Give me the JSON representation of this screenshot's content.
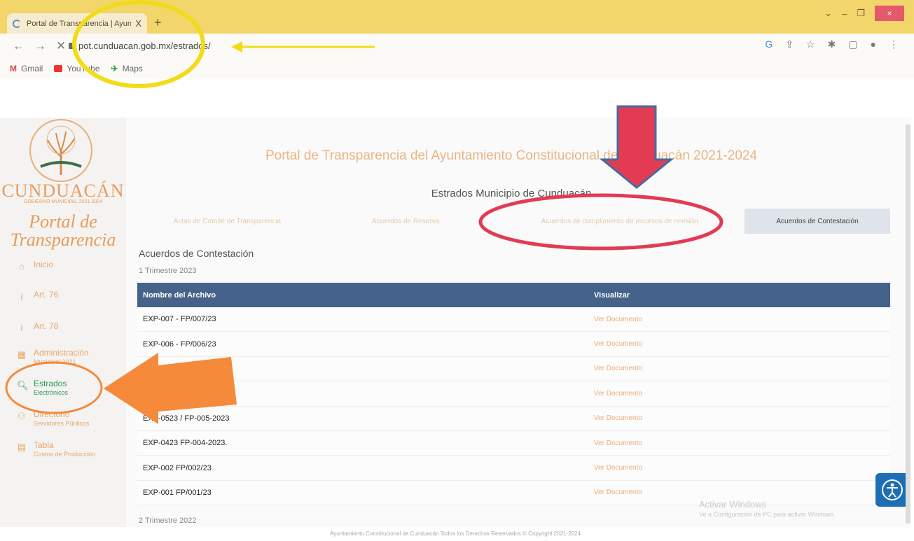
{
  "browser": {
    "tab_title": "Portal de Transparencia | Ayuntam",
    "tab_close": "X",
    "new_tab": "+",
    "url": "pot.cunduacan.gob.mx/estrados/",
    "bookmarks": [
      {
        "label": "Gmail",
        "icon": "gmail-icon"
      },
      {
        "label": "YouTube",
        "icon": "youtube-icon"
      },
      {
        "label": "Maps",
        "icon": "maps-icon"
      }
    ],
    "window_close": "×"
  },
  "sidebar": {
    "logo_text": "CUNDUACÁN",
    "logo_sub": "GOBIERNO MUNICIPAL 2021-2024",
    "portal_line1": "Portal de",
    "portal_line2": "Transparencia",
    "items": [
      {
        "label": "Inicio",
        "sub": "",
        "icon": "home-icon"
      },
      {
        "label": "Art. 76",
        "sub": "",
        "icon": "info-icon"
      },
      {
        "label": "Art. 78",
        "sub": "",
        "icon": "info-icon"
      },
      {
        "label": "Administración",
        "sub": "Municipal 2021",
        "icon": "calendar-icon"
      },
      {
        "label": "Estrados",
        "sub": "Electrónicos",
        "icon": "search-icon"
      },
      {
        "label": "Directorio",
        "sub": "Servidores Públicos",
        "icon": "people-icon"
      },
      {
        "label": "Tabla",
        "sub": "Costos de Producción",
        "icon": "table-icon"
      }
    ]
  },
  "content": {
    "site_title": "Portal de Transparencia del Ayuntamiento Constitucional de Cunduacán  2021-2024",
    "estrados_title": "Estrados Municipio de Cunduacán",
    "tabs": [
      "Actas de Comité de Transparencia",
      "Acuerdos de Reserva",
      "Acuerdos de cumplimiento de recursos de revisión",
      "Acuerdos de Contestación"
    ],
    "section_heading": "Acuerdos de Contestación",
    "period": "1 Trimestre 2023",
    "table": {
      "col_name": "Nombre del Archivo",
      "col_view": "Visualizar",
      "rows": [
        {
          "name": "EXP-007 - FP/007/23",
          "view": "Ver Documento"
        },
        {
          "name": "EXP-006 - FP/006/23",
          "view": "Ver Documento"
        },
        {
          "name": "",
          "view": "Ver Documento"
        },
        {
          "name": "",
          "view": "Ver Documento"
        },
        {
          "name": "EXP-0523 / FP-005-2023",
          "view": "Ver Documento"
        },
        {
          "name": "EXP-0423 FP-004-2023.",
          "view": "Ver Documento"
        },
        {
          "name": "EXP-002 FP/002/23",
          "view": "Ver Documento"
        },
        {
          "name": "EXP-001 FP/001/23",
          "view": "Ver Documento"
        }
      ]
    },
    "next_period": "2 Trimestre 2022",
    "watermark_title": "Activar Windows",
    "watermark_sub": "Ve a Configuración de PC para activar Windows."
  },
  "footer": "Ayuntamiento Constitucional de Cunduacán Todos los Derechos Reservados © Copyright 2021-2024",
  "colors": {
    "accent_orange": "#e8a66d",
    "table_header": "#44628a",
    "active_green": "#2a9a54",
    "annotation_yellow": "#f2dc1a",
    "annotation_red": "#e23b52",
    "annotation_orange": "#f48a3a"
  }
}
